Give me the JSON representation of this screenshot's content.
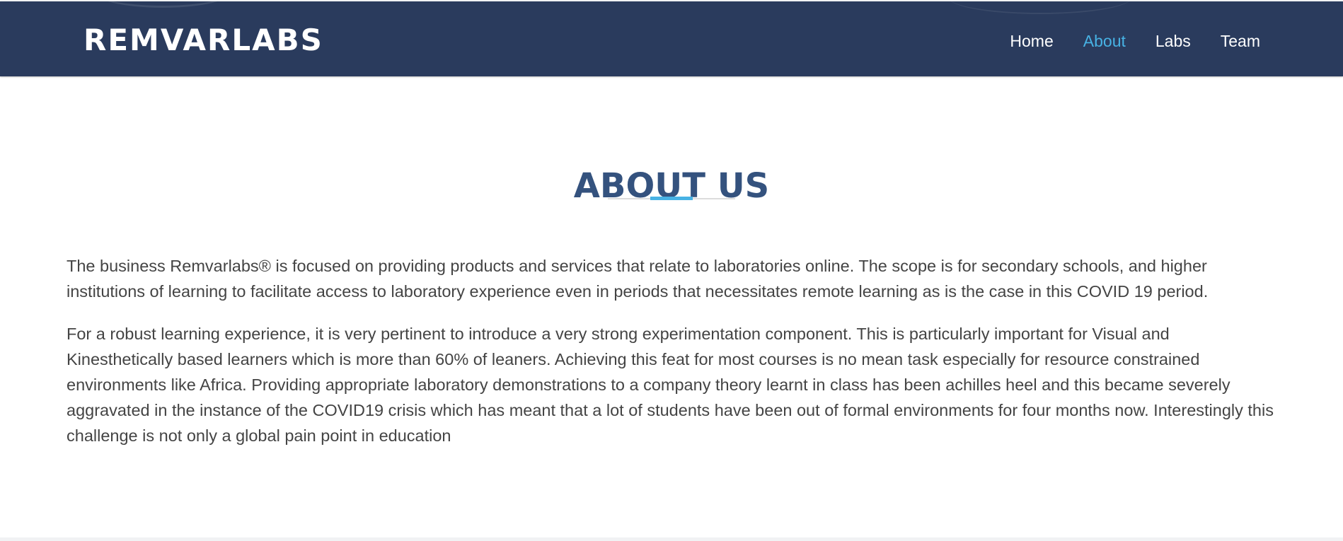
{
  "header": {
    "logo": "REMVARLABS",
    "nav": [
      {
        "label": "Home",
        "active": false
      },
      {
        "label": "About",
        "active": true
      },
      {
        "label": "Labs",
        "active": false
      },
      {
        "label": "Team",
        "active": false
      }
    ]
  },
  "about": {
    "title": "ABOUT US",
    "paragraphs": [
      "The business Remvarlabs® is focused on providing products and services that relate to laboratories online. The scope is for secondary schools, and higher institutions of learning to facilitate access to laboratory experience even in periods that necessitates remote learning as is the case in this COVID 19 period.",
      "For a robust learning experience, it is very pertinent to introduce a very strong experimentation component. This is particularly important for Visual and Kinesthetically based learners which is more than 60% of leaners. Achieving this feat for most courses is no mean task especially for resource constrained environments like Africa. Providing appropriate laboratory demonstrations to a company theory learnt in class has been achilles heel and this became severely aggravated in the instance of the COVID19 crisis which has meant that a lot of students have been out of formal environments for four months now. Interestingly this challenge is not only a global pain point in education"
    ]
  },
  "colors": {
    "header_bg": "#2a3b5d",
    "accent": "#47b2e4",
    "title": "#34527e",
    "body_text": "#444444"
  }
}
